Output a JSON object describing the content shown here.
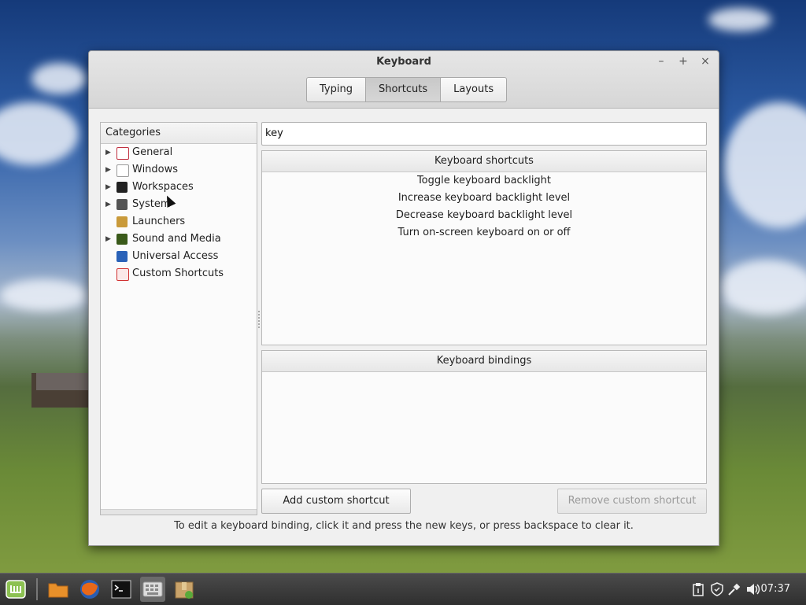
{
  "window": {
    "title": "Keyboard",
    "minimize": "–",
    "maximize": "+",
    "close": "×"
  },
  "tabs": [
    {
      "label": "Typing"
    },
    {
      "label": "Shortcuts",
      "active": true
    },
    {
      "label": "Layouts"
    }
  ],
  "sidebar": {
    "header": "Categories",
    "items": [
      {
        "label": "General",
        "expandable": true,
        "icon": "general-icon",
        "color": "#c03040"
      },
      {
        "label": "Windows",
        "expandable": true,
        "icon": "windows-icon",
        "color": "#dddddd"
      },
      {
        "label": "Workspaces",
        "expandable": true,
        "icon": "workspaces-icon",
        "color": "#222222"
      },
      {
        "label": "System",
        "expandable": true,
        "icon": "system-icon",
        "color": "#555555"
      },
      {
        "label": "Launchers",
        "expandable": false,
        "icon": "launchers-icon",
        "color": "#c99a3a"
      },
      {
        "label": "Sound and Media",
        "expandable": true,
        "icon": "sound-media-icon",
        "color": "#3a5a1a"
      },
      {
        "label": "Universal Access",
        "expandable": false,
        "icon": "accessibility-icon",
        "color": "#2a62b8"
      },
      {
        "label": "Custom Shortcuts",
        "expandable": false,
        "icon": "custom-shortcuts-icon",
        "color": "#d03030"
      }
    ]
  },
  "search": {
    "value": "key"
  },
  "shortcuts_panel": {
    "header": "Keyboard shortcuts",
    "items": [
      "Toggle keyboard backlight",
      "Increase keyboard backlight level",
      "Decrease keyboard backlight level",
      "Turn on-screen keyboard on or off"
    ]
  },
  "bindings_panel": {
    "header": "Keyboard bindings"
  },
  "buttons": {
    "add": "Add custom shortcut",
    "remove": "Remove custom shortcut"
  },
  "hint": "To edit a keyboard binding, click it and press the new keys, or press backspace to clear it.",
  "taskbar": {
    "clock": "07:37"
  }
}
